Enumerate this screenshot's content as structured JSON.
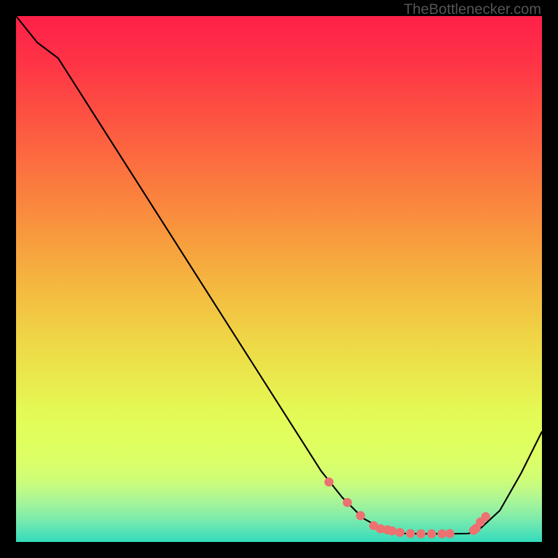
{
  "watermark": "TheBottlenecker.com",
  "chart_data": {
    "type": "line",
    "xlim": [
      0,
      100
    ],
    "ylim": [
      0,
      100
    ],
    "title": "",
    "xlabel": "",
    "ylabel": "",
    "series": [
      {
        "name": "curve",
        "x": [
          0,
          4,
          8,
          58,
          62,
          66,
          70,
          74,
          78,
          82,
          86,
          88,
          92,
          96,
          100
        ],
        "y": [
          100,
          95,
          92,
          13.5,
          8.5,
          4.5,
          2.3,
          1.6,
          1.55,
          1.55,
          1.6,
          2.3,
          6,
          13,
          21
        ]
      }
    ],
    "markers": {
      "name": "dots",
      "color": "#ec7170",
      "x": [
        59.5,
        63,
        65.5,
        68,
        69.3,
        70.6,
        71.5,
        73,
        75,
        77,
        79,
        81,
        82.5,
        87,
        87.5,
        88.3,
        89.3
      ],
      "y": [
        11.4,
        7.5,
        5,
        3.1,
        2.5,
        2.3,
        2.1,
        1.8,
        1.6,
        1.55,
        1.55,
        1.55,
        1.6,
        2.2,
        2.6,
        3.8,
        4.8
      ]
    },
    "gradient_stops": [
      {
        "offset": 0.0,
        "color": "#fe2049"
      },
      {
        "offset": 0.09,
        "color": "#fe3446"
      },
      {
        "offset": 0.18,
        "color": "#fd4f42"
      },
      {
        "offset": 0.27,
        "color": "#fc6b40"
      },
      {
        "offset": 0.36,
        "color": "#fa873e"
      },
      {
        "offset": 0.45,
        "color": "#f7a43e"
      },
      {
        "offset": 0.54,
        "color": "#f3c041"
      },
      {
        "offset": 0.63,
        "color": "#eeda47"
      },
      {
        "offset": 0.72,
        "color": "#e7f151"
      },
      {
        "offset": 0.75,
        "color": "#e4f955"
      },
      {
        "offset": 0.8,
        "color": "#e0ff5d"
      },
      {
        "offset": 0.84,
        "color": "#ddff66"
      },
      {
        "offset": 0.88,
        "color": "#d0fd76"
      },
      {
        "offset": 0.905,
        "color": "#bbf98a"
      },
      {
        "offset": 0.93,
        "color": "#9ff39c"
      },
      {
        "offset": 0.955,
        "color": "#7eecab"
      },
      {
        "offset": 0.975,
        "color": "#5ee4b4"
      },
      {
        "offset": 0.99,
        "color": "#43deb9"
      },
      {
        "offset": 1.0,
        "color": "#33dabb"
      }
    ]
  }
}
